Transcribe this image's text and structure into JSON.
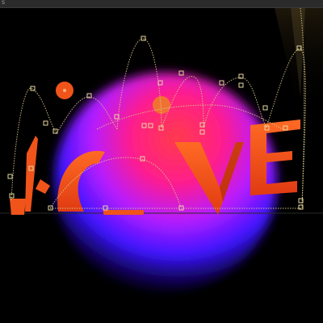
{
  "window": {
    "tab_text": "s"
  },
  "artwork": {
    "word": "LOVE",
    "palette": {
      "background": "#000000",
      "sphere_hot": "#ff2a6a",
      "sphere_mid": "#c020ff",
      "sphere_cool": "#2a10ff",
      "glyph": "#f0541a",
      "glyph_shadow": "#b3290c",
      "motion_path": "#d8c98a"
    }
  }
}
